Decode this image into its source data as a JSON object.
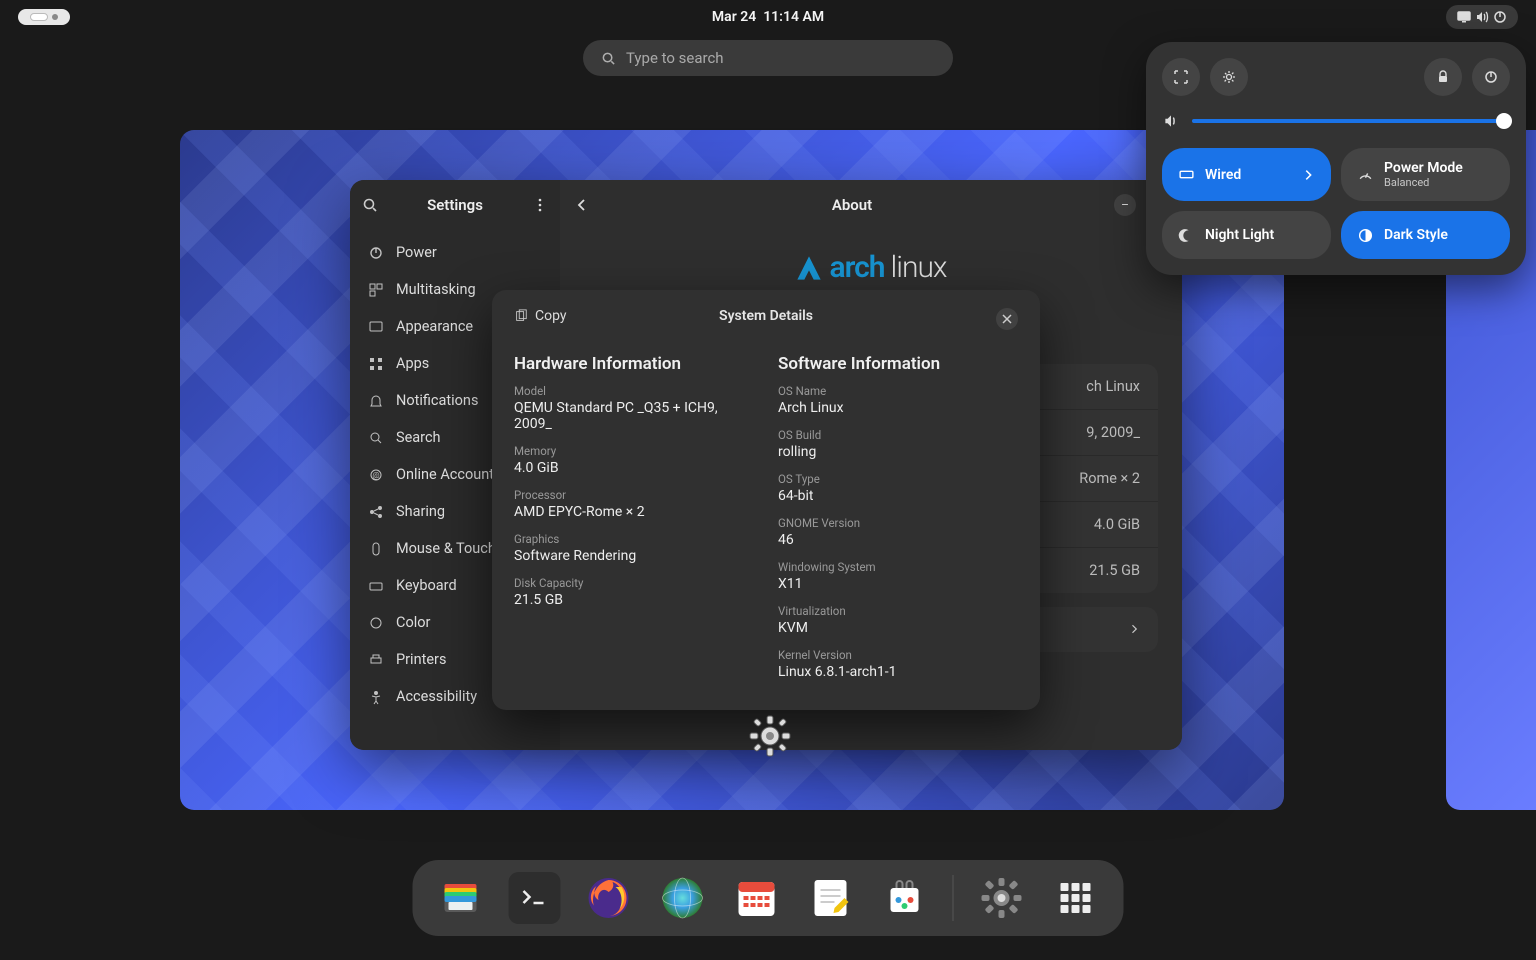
{
  "topbar": {
    "date": "Mar 24",
    "time": "11:14 AM"
  },
  "search": {
    "placeholder": "Type to search"
  },
  "settings": {
    "title": "Settings",
    "content_title": "About",
    "sidebar_items": [
      "Power",
      "Multitasking",
      "Appearance",
      "Apps",
      "Notifications",
      "Search",
      "Online Account",
      "Sharing",
      "Mouse & Touch",
      "Keyboard",
      "Color",
      "Printers",
      "Accessibility"
    ],
    "arch_txt1": "arch",
    "arch_txt2": "linux",
    "about_rows": [
      {
        "k": "",
        "v": "ch Linux"
      },
      {
        "k": "",
        "v": "9, 2009_"
      },
      {
        "k": "",
        "v": "Rome × 2"
      },
      {
        "k": "",
        "v": "4.0 GiB"
      },
      {
        "k": "Disk Capacity",
        "v": "21.5 GB"
      }
    ],
    "sysdet_label": "System Details"
  },
  "modal": {
    "title": "System Details",
    "copy": "Copy",
    "hw_title": "Hardware Information",
    "sw_title": "Software Information",
    "hw": [
      {
        "lab": "Model",
        "val": "QEMU Standard PC _Q35 + ICH9, 2009_"
      },
      {
        "lab": "Memory",
        "val": "4.0 GiB"
      },
      {
        "lab": "Processor",
        "val": "AMD EPYC-Rome × 2"
      },
      {
        "lab": "Graphics",
        "val": "Software Rendering"
      },
      {
        "lab": "Disk Capacity",
        "val": "21.5 GB"
      }
    ],
    "sw": [
      {
        "lab": "OS Name",
        "val": "Arch Linux"
      },
      {
        "lab": "OS Build",
        "val": "rolling"
      },
      {
        "lab": "OS Type",
        "val": "64-bit"
      },
      {
        "lab": "GNOME Version",
        "val": "46"
      },
      {
        "lab": "Windowing System",
        "val": "X11"
      },
      {
        "lab": "Virtualization",
        "val": "KVM"
      },
      {
        "lab": "Kernel Version",
        "val": "Linux 6.8.1-arch1-1"
      }
    ]
  },
  "qs": {
    "wired": "Wired",
    "power_mode": "Power Mode",
    "power_mode_sub": "Balanced",
    "night_light": "Night Light",
    "dark_style": "Dark Style"
  }
}
